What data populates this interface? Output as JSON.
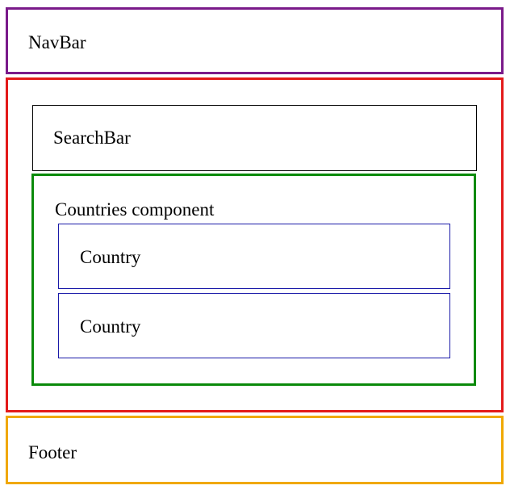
{
  "navbar": {
    "label": "NavBar",
    "color": "#7a1a8a"
  },
  "main": {
    "color": "#e31a1a"
  },
  "searchbar": {
    "label": "SearchBar",
    "color": "#000000"
  },
  "countries": {
    "label": "Countries component",
    "color": "#0a8a0a",
    "items": [
      {
        "label": "Country",
        "color": "#1a1aa8"
      },
      {
        "label": "Country",
        "color": "#1a1aa8"
      }
    ]
  },
  "footer": {
    "label": "Footer",
    "color": "#f0a800"
  }
}
